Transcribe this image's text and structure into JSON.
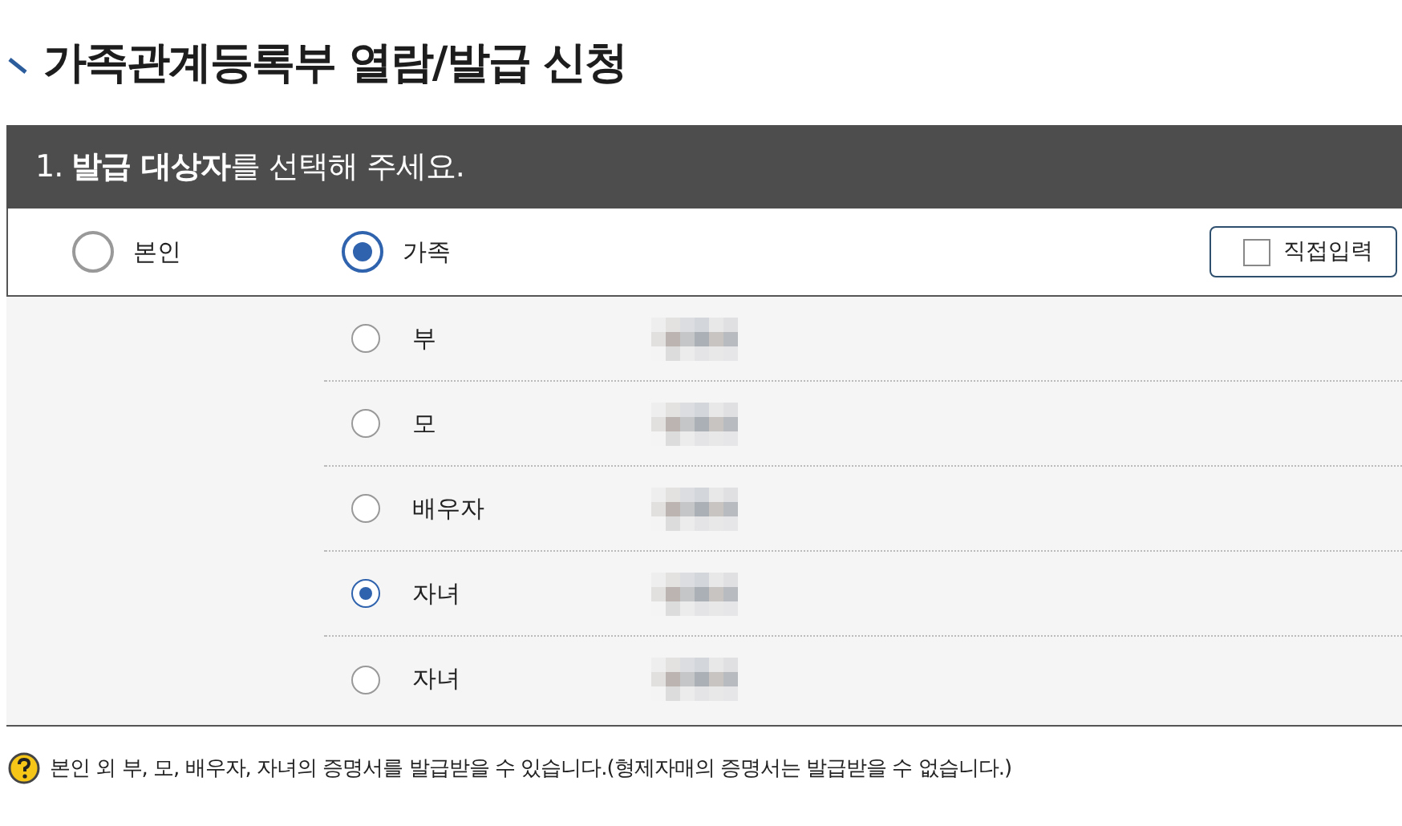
{
  "title": "가족관계등록부 열람/발급 신청",
  "section": {
    "heading": "1. **발급 대상자**를 선택해 주세요.",
    "targets": [
      {
        "label": "본인",
        "selected": false
      },
      {
        "label": "가족",
        "selected": true
      }
    ],
    "direct_input": {
      "label": "직접입력",
      "checked": false
    }
  },
  "family": [
    {
      "relation": "부",
      "selected": false
    },
    {
      "relation": "모",
      "selected": false
    },
    {
      "relation": "배우자",
      "selected": false
    },
    {
      "relation": "자녀",
      "selected": true
    },
    {
      "relation": "자녀",
      "selected": false
    }
  ],
  "note": "본인 외 부, 모, 배우자, 자녀의 증명서를 발급받을 수 있습니다.(형제자매의 증명서는 발급받을 수 없습니다.)"
}
